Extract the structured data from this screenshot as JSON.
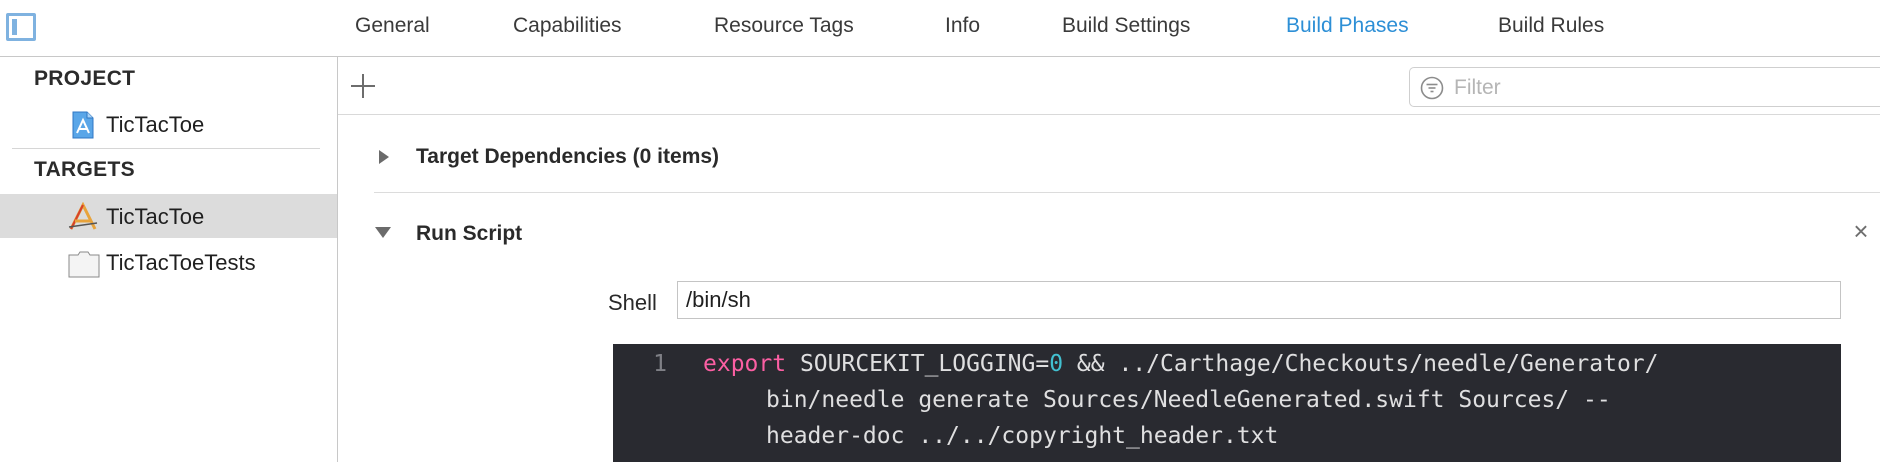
{
  "tabs": [
    {
      "label": "General",
      "active": false
    },
    {
      "label": "Capabilities",
      "active": false
    },
    {
      "label": "Resource Tags",
      "active": false
    },
    {
      "label": "Info",
      "active": false
    },
    {
      "label": "Build Settings",
      "active": false
    },
    {
      "label": "Build Phases",
      "active": true
    },
    {
      "label": "Build Rules",
      "active": false
    }
  ],
  "sidebar": {
    "project_header": "PROJECT",
    "project_items": [
      {
        "label": "TicTacToe",
        "icon": "xcode-project-icon"
      }
    ],
    "targets_header": "TARGETS",
    "target_items": [
      {
        "label": "TicTacToe",
        "icon": "app-target-icon",
        "selected": true
      },
      {
        "label": "TicTacToeTests",
        "icon": "test-bundle-icon",
        "selected": false
      }
    ]
  },
  "toolbar": {
    "add_icon": "plus-icon",
    "filter_placeholder": "Filter",
    "filter_value": ""
  },
  "phases": {
    "target_dependencies": {
      "title": "Target Dependencies (0 items)",
      "expanded": false
    },
    "run_script": {
      "title": "Run Script",
      "expanded": true,
      "shell_label": "Shell",
      "shell_value": "/bin/sh",
      "script": {
        "line_number": "1",
        "keyword": "export",
        "var_name": " SOURCEKIT_LOGGING=",
        "value": "0",
        "line1_rest": " && ../Carthage/Checkouts/needle/Generator/",
        "line2": "bin/needle generate Sources/NeedleGenerated.swift Sources/ --",
        "line3": "header-doc ../../copyright_header.txt"
      }
    }
  },
  "colors": {
    "accent": "#2d8fd6",
    "code_background": "#292a30",
    "code_keyword": "#fc5fa3",
    "code_number": "#42c0d0",
    "code_text": "#dfdfe0"
  }
}
